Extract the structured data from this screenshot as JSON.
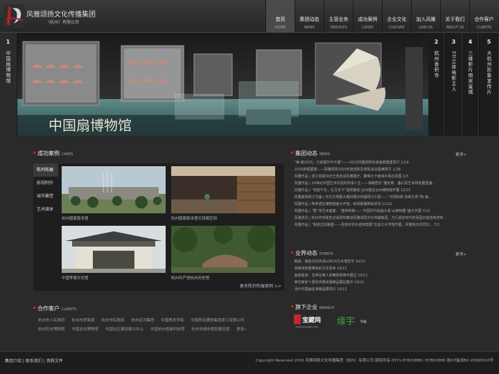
{
  "header": {
    "logo_text": "风雅颂扬文化传播集团",
    "logo_sub": "（杭州）有限公司"
  },
  "nav": [
    {
      "cn": "首页",
      "en": "HOME"
    },
    {
      "cn": "集团动态",
      "en": "NEWS"
    },
    {
      "cn": "主营业务",
      "en": "SERVICES"
    },
    {
      "cn": "成功案例",
      "en": "CASES"
    },
    {
      "cn": "企业文化",
      "en": "CULTURE"
    },
    {
      "cn": "加入风雅",
      "en": "JOIN US"
    },
    {
      "cn": "关于我们",
      "en": "ABOUT US"
    },
    {
      "cn": "合作客户",
      "en": "CLIENTS"
    }
  ],
  "banner": {
    "tabs": [
      {
        "num": "1",
        "label": "中国扇博物馆"
      },
      {
        "num": "2",
        "label": "杭州香积寺"
      },
      {
        "num": "3",
        "label": "3D立体电影主人"
      },
      {
        "num": "4",
        "label": "三维影片南宋皇城"
      },
      {
        "num": "5",
        "label": "大杭州形象宣传片"
      }
    ],
    "caption": "中国扇博物馆"
  },
  "cases": {
    "title": "成功案例",
    "title_en": "CASES",
    "menu": [
      "陈列布展",
      "影视制作",
      "城市雕塑",
      "艺术媒体"
    ],
    "items": [
      {
        "caption": "杭州国家版本馆"
      },
      {
        "caption": "杭州国家版本馆文润阁空间"
      },
      {
        "caption": "中国孝德文化馆"
      },
      {
        "caption": "杭州共产党杭州历史馆"
      }
    ],
    "more": "更多陈列布展案例 >>"
  },
  "news": {
    "title": "集团动态",
    "title_en": "NEWS",
    "more": "更多»",
    "items": [
      "“稀·宴2025」已启幕升升不疆”——2025风雅颂扬年度盛典隆重举行  1/19",
      "2025新程展望——风雅颂扬2024年度述职及表彰会议圆满举行  1/18",
      "风雅作品 | 浙江省委书记王浩走进风雅展厅，聚焦大下姜城乡融合发展  1/3",
      "风雅作品 | 20世纪中国艺术日前的传承人生——演峨悲论“潘天寿、潘公凯艺术研究展暨潘...",
      "风雅作品 | “宋韵千年，礼行天下”首现敬动·台州展在台州博物馆开展  12/22",
      "风雅案例研讨方面 | 中华文明重大题材展示传播研讨工程——“光明四表 协和万邦”陶·诸...",
      "风雅作品 | 陶寺遗址博物馆盛大开馆，新闻联播带来资讯  11/13",
      "风雅作品 | “群”享艺术盛宴，“盛世修典——‘中国历代绘画大系’山西特展”盛大开展  7/12",
      "风雅资讯 | 杭州市传联史访谈研究推进风雅颂扬文化传播集团，力行道崇时代的责园日首选地培养...",
      "风雅作品 | “我走过的路楚——圣徐芬农手迹特案展”在浙江大学馆开展，风雅连日共同切...  7/2"
    ]
  },
  "events": {
    "title": "业界动态",
    "title_en": "EVENTS",
    "more": "更多»",
    "items": [
      "韩成：暴韵书法传承LOEUS艺术博览节  10/11",
      "普格塔桂香带来的文化思考  10/11",
      "画家夏宫：生命在奉人的精情真等中展过  10/11",
      "西华西安十周年庆典晃晨精品展征集中  10/11",
      "当代中国画名家精品展举行  10/11"
    ]
  },
  "branch": {
    "title": "旗下企业",
    "title_en": "BRANCH",
    "logo1": "宝藏网",
    "logo1_sub": "WWW.BAOZANG.COM",
    "logo2": "缘宇",
    "logo2_sub": "书画"
  },
  "clients": {
    "title": "合作客户",
    "title_en": "CLIENTS",
    "items": [
      "杭州市人民政府",
      "杭州市贸易局",
      "杭州市民政局",
      "杭州运河集团",
      "中国美术学院",
      "中国移动通信集团浙江有限公司",
      "杭州历史博物馆",
      "中国谷仓博物馆",
      "中国社区建设展示中心",
      "中国杭州低碳科技馆",
      "杭州市城市规划展览馆",
      "更多»"
    ]
  },
  "footer": {
    "links": [
      "集团介绍",
      "联系我们",
      "资质文件"
    ],
    "separator": " | ",
    "copyright": "Copyright Reserved 2016 风雅颂扬文化传播集团（杭州）有限公司 版权所有 0571-87815888 / 87802888 浙ICP备浙B2-20090010号"
  },
  "colors": {
    "accent": "#c1272d",
    "background": "#2a2a2a",
    "banner_title": "#e8e2d0"
  }
}
